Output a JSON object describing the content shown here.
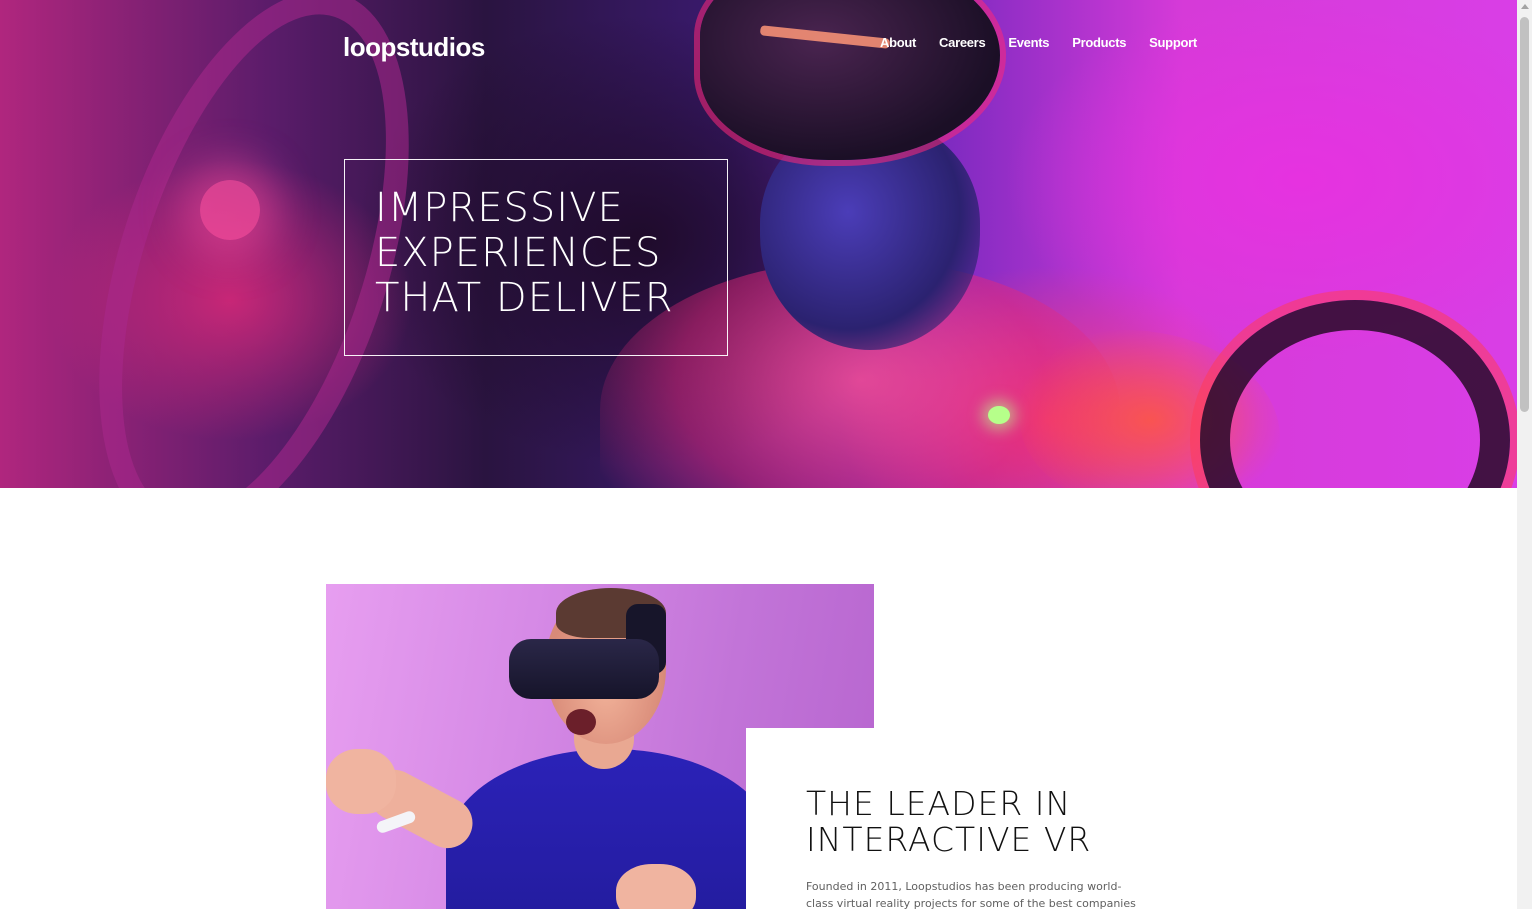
{
  "header": {
    "logo": "loopstudios",
    "nav": [
      "About",
      "Careers",
      "Events",
      "Products",
      "Support"
    ]
  },
  "hero": {
    "headline_lines": [
      "IMPRESSIVE",
      "EXPERIENCES",
      "THAT DELIVER"
    ]
  },
  "interactive": {
    "title_lines": [
      "THE LEADER IN",
      "INTERACTIVE VR"
    ],
    "body": "Founded in 2011, Loopstudios has been producing world-class virtual reality projects for some of the best companies around the"
  },
  "colors": {
    "hero_accent": "#d93ee6",
    "text_dark": "#111111",
    "text_muted": "#606060",
    "white": "#ffffff"
  }
}
